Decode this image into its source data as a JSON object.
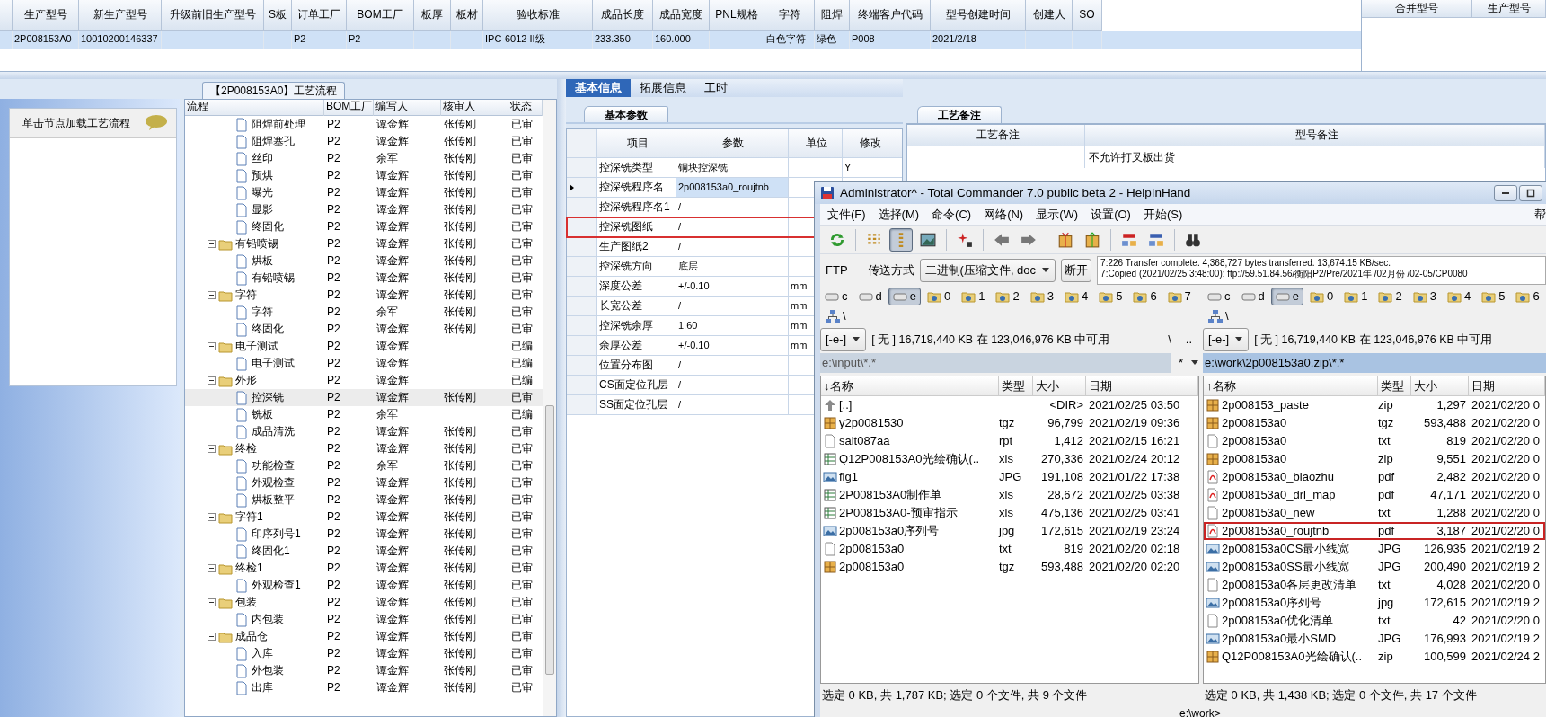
{
  "top_grid": {
    "columns": [
      "生产型号",
      "新生产型号",
      "升级前旧生产型号",
      "S板",
      "订单工厂",
      "BOM工厂",
      "板厚",
      "板材",
      "验收标准",
      "成品长度",
      "成品宽度",
      "PNL规格",
      "字符",
      "阻焊",
      "终端客户代码",
      "型号创建时间",
      "创建人",
      "SO"
    ],
    "rows": [
      {
        "selected": true,
        "cells": [
          "2P008153A0",
          "10010200146337",
          null,
          null,
          "P2",
          "P2",
          null,
          null,
          "IPC-6012 II级",
          "233.350",
          "160.000",
          null,
          "白色字符",
          "绿色",
          "P008",
          "2021/2/18",
          null,
          null
        ]
      }
    ]
  },
  "merge_grid": {
    "columns": [
      "合并型号",
      "生产型号"
    ]
  },
  "process_panel": {
    "title": "【2P008153A0】工艺流程",
    "hint": "单击节点加载工艺流程",
    "columns": [
      "流程",
      "BOM工厂",
      "编写人",
      "核审人",
      "状态"
    ],
    "items": [
      {
        "kind": "file",
        "name": "阻焊前处理",
        "cells": [
          "P2",
          "谭金辉",
          "张传刚",
          "已审"
        ],
        "selected": false
      },
      {
        "kind": "file",
        "name": "阻焊塞孔",
        "cells": [
          "P2",
          "谭金辉",
          "张传刚",
          "已审"
        ],
        "selected": false
      },
      {
        "kind": "file",
        "name": "丝印",
        "cells": [
          "P2",
          "余军",
          "张传刚",
          "已审"
        ],
        "selected": false
      },
      {
        "kind": "file",
        "name": "预烘",
        "cells": [
          "P2",
          "谭金辉",
          "张传刚",
          "已审"
        ],
        "selected": false
      },
      {
        "kind": "file",
        "name": "曝光",
        "cells": [
          "P2",
          "谭金辉",
          "张传刚",
          "已审"
        ],
        "selected": false
      },
      {
        "kind": "file",
        "name": "显影",
        "cells": [
          "P2",
          "谭金辉",
          "张传刚",
          "已审"
        ],
        "selected": false
      },
      {
        "kind": "file",
        "name": "终固化",
        "cells": [
          "P2",
          "谭金辉",
          "张传刚",
          "已审"
        ],
        "selected": false
      },
      {
        "kind": "folder",
        "name": "有铅喷锡",
        "cells": [
          "P2",
          "谭金辉",
          "张传刚",
          "已审"
        ],
        "selected": false,
        "expanded": true,
        "children": [
          {
            "kind": "file",
            "name": "烘板",
            "cells": [
              "P2",
              "谭金辉",
              "张传刚",
              "已审"
            ],
            "selected": false
          },
          {
            "kind": "file",
            "name": "有铅喷锡",
            "cells": [
              "P2",
              "谭金辉",
              "张传刚",
              "已审"
            ],
            "selected": false
          }
        ]
      },
      {
        "kind": "folder",
        "name": "字符",
        "cells": [
          "P2",
          "谭金辉",
          "张传刚",
          "已审"
        ],
        "selected": false,
        "expanded": true,
        "children": [
          {
            "kind": "file",
            "name": "字符",
            "cells": [
              "P2",
              "余军",
              "张传刚",
              "已审"
            ],
            "selected": false
          },
          {
            "kind": "file",
            "name": "终固化",
            "cells": [
              "P2",
              "谭金辉",
              "张传刚",
              "已审"
            ],
            "selected": false
          }
        ]
      },
      {
        "kind": "folder",
        "name": "电子测试",
        "cells": [
          "P2",
          "谭金辉",
          null,
          "已编"
        ],
        "selected": false,
        "expanded": true,
        "children": [
          {
            "kind": "file",
            "name": "电子测试",
            "cells": [
              "P2",
              "谭金辉",
              null,
              "已编"
            ],
            "selected": false
          }
        ]
      },
      {
        "kind": "folder",
        "name": "外形",
        "cells": [
          "P2",
          "谭金辉",
          null,
          "已编"
        ],
        "selected": false,
        "expanded": true,
        "children": [
          {
            "kind": "file",
            "name": "控深铣",
            "cells": [
              "P2",
              "谭金辉",
              "张传刚",
              "已审"
            ],
            "selected": true
          },
          {
            "kind": "file",
            "name": "铣板",
            "cells": [
              "P2",
              "余军",
              null,
              "已编"
            ],
            "selected": false
          },
          {
            "kind": "file",
            "name": "成品清洗",
            "cells": [
              "P2",
              "谭金辉",
              "张传刚",
              "已审"
            ],
            "selected": false
          }
        ]
      },
      {
        "kind": "folder",
        "name": "终检",
        "cells": [
          "P2",
          "谭金辉",
          "张传刚",
          "已审"
        ],
        "selected": false,
        "expanded": true,
        "children": [
          {
            "kind": "file",
            "name": "功能检查",
            "cells": [
              "P2",
              "余军",
              "张传刚",
              "已审"
            ],
            "selected": false
          },
          {
            "kind": "file",
            "name": "外观检查",
            "cells": [
              "P2",
              "谭金辉",
              "张传刚",
              "已审"
            ],
            "selected": false
          },
          {
            "kind": "file",
            "name": "烘板整平",
            "cells": [
              "P2",
              "谭金辉",
              "张传刚",
              "已审"
            ],
            "selected": false
          }
        ]
      },
      {
        "kind": "folder",
        "name": "字符1",
        "cells": [
          "P2",
          "谭金辉",
          "张传刚",
          "已审"
        ],
        "selected": false,
        "expanded": true,
        "children": [
          {
            "kind": "file",
            "name": "印序列号1",
            "cells": [
              "P2",
              "谭金辉",
              "张传刚",
              "已审"
            ],
            "selected": false
          },
          {
            "kind": "file",
            "name": "终固化1",
            "cells": [
              "P2",
              "谭金辉",
              "张传刚",
              "已审"
            ],
            "selected": false
          }
        ]
      },
      {
        "kind": "folder",
        "name": "终检1",
        "cells": [
          "P2",
          "谭金辉",
          "张传刚",
          "已审"
        ],
        "selected": false,
        "expanded": true,
        "children": [
          {
            "kind": "file",
            "name": "外观检查1",
            "cells": [
              "P2",
              "谭金辉",
              "张传刚",
              "已审"
            ],
            "selected": false
          }
        ]
      },
      {
        "kind": "folder",
        "name": "包装",
        "cells": [
          "P2",
          "谭金辉",
          "张传刚",
          "已审"
        ],
        "selected": false,
        "expanded": true,
        "children": [
          {
            "kind": "file",
            "name": "内包装",
            "cells": [
              "P2",
              "谭金辉",
              "张传刚",
              "已审"
            ],
            "selected": false
          }
        ]
      },
      {
        "kind": "folder",
        "name": "成品仓",
        "cells": [
          "P2",
          "谭金辉",
          "张传刚",
          "已审"
        ],
        "selected": false,
        "expanded": true,
        "children": [
          {
            "kind": "file",
            "name": "入库",
            "cells": [
              "P2",
              "谭金辉",
              "张传刚",
              "已审"
            ],
            "selected": false
          },
          {
            "kind": "file",
            "name": "外包装",
            "cells": [
              "P2",
              "谭金辉",
              "张传刚",
              "已审"
            ],
            "selected": false
          },
          {
            "kind": "file",
            "name": "出库",
            "cells": [
              "P2",
              "谭金辉",
              "张传刚",
              "已审"
            ],
            "selected": false
          }
        ]
      }
    ]
  },
  "info_tabs": [
    {
      "label": "基本信息",
      "selected": true
    },
    {
      "label": "拓展信息",
      "selected": false
    },
    {
      "label": "工时",
      "selected": false
    }
  ],
  "params": {
    "tab": "基本参数",
    "columns": [
      "项目",
      "参数",
      "单位",
      "修改"
    ],
    "rows": [
      {
        "item": "控深铣类型",
        "value": "铜块控深铣",
        "modify": "Y",
        "selected": false,
        "highlighted": false
      },
      {
        "item": "控深铣程序名",
        "value": "2p008153a0_roujtnb",
        "selected": true,
        "highlighted": false
      },
      {
        "item": "控深铣程序名1",
        "value": "/",
        "selected": false,
        "highlighted": false
      },
      {
        "item": "控深铣图纸",
        "value": "/",
        "selected": false,
        "highlighted": true
      },
      {
        "item": "生产图纸2",
        "value": "/",
        "selected": false,
        "highlighted": false
      },
      {
        "item": "控深铣方向",
        "value": "底层",
        "selected": false,
        "highlighted": false
      },
      {
        "item": "深度公差",
        "value": "+/-0.10",
        "unit": "mm",
        "selected": false,
        "highlighted": false
      },
      {
        "item": "长宽公差",
        "value": "/",
        "unit": "mm",
        "selected": false,
        "highlighted": false
      },
      {
        "item": "控深铣余厚",
        "value": "1.60",
        "unit": "mm",
        "selected": false,
        "highlighted": false
      },
      {
        "item": "余厚公差",
        "value": "+/-0.10",
        "unit": "mm",
        "selected": false,
        "highlighted": false
      },
      {
        "item": "位置分布图",
        "value": "/",
        "selected": false,
        "highlighted": false
      },
      {
        "item": "CS面定位孔层",
        "value": "/",
        "selected": false,
        "highlighted": false
      },
      {
        "item": "SS面定位孔层",
        "value": "/",
        "selected": false,
        "highlighted": false
      }
    ]
  },
  "notes": {
    "tab": "工艺备注",
    "columns": [
      "工艺备注",
      "型号备注"
    ],
    "model_note": "不允许打叉板出货"
  },
  "file_manager": {
    "title": "Administrator^ - Total Commander 7.0 public beta 2 - HelpInHand",
    "menu": [
      "文件(F)",
      "选择(M)",
      "命令(C)",
      "网络(N)",
      "显示(W)",
      "设置(O)",
      "开始(S)",
      "帮"
    ],
    "toolbar": [
      {
        "kind": "refresh",
        "selected": false
      },
      {
        "kind": "separator"
      },
      {
        "kind": "brief",
        "selected": false
      },
      {
        "kind": "detailed",
        "selected": true
      },
      {
        "kind": "thumbnails",
        "selected": false
      },
      {
        "kind": "separator"
      },
      {
        "kind": "star",
        "selected": false
      },
      {
        "kind": "separator"
      },
      {
        "kind": "back",
        "selected": false
      },
      {
        "kind": "forward",
        "selected": false
      },
      {
        "kind": "separator"
      },
      {
        "kind": "pack",
        "selected": false
      },
      {
        "kind": "unpack",
        "selected": false
      },
      {
        "kind": "separator"
      },
      {
        "kind": "ftp",
        "selected": false
      },
      {
        "kind": "url",
        "selected": false
      },
      {
        "kind": "separator"
      },
      {
        "kind": "find",
        "selected": false
      }
    ],
    "ftp": {
      "label": "FTP",
      "mode_label": "传送方式",
      "mode": "二进制(压缩文件, doc",
      "disconnect": "断开",
      "log": [
        "7:226 Transfer complete. 4,368,727 bytes transferred. 13,674.15 KB/sec.",
        "7:Copied (2021/02/25 3:48:00): ftp://59.51.84.56/衡阳P2/Pre/2021年 /02月份 /02-05/CP0080"
      ]
    },
    "panels": [
      {
        "active": false,
        "drives": [
          {
            "kind": "disk",
            "label": "c",
            "selected": false
          },
          {
            "kind": "disk",
            "label": "d",
            "selected": false
          },
          {
            "kind": "disk",
            "label": "e",
            "selected": true
          },
          {
            "kind": "net",
            "label": "0",
            "selected": false
          },
          {
            "kind": "net",
            "label": "1",
            "selected": false
          },
          {
            "kind": "net",
            "label": "2",
            "selected": false
          },
          {
            "kind": "net",
            "label": "3",
            "selected": false
          },
          {
            "kind": "net",
            "label": "4",
            "selected": false
          },
          {
            "kind": "net",
            "label": "5",
            "selected": false
          },
          {
            "kind": "net",
            "label": "6",
            "selected": false
          },
          {
            "kind": "net",
            "label": "7",
            "selected": false
          }
        ],
        "root": "\\",
        "drive": "[-e-]",
        "free_space": "[ 无 ]  16,719,440 KB 在 123,046,976 KB 中可用",
        "nav": [
          "\\",
          ".."
        ],
        "path": "e:\\input\\*.*",
        "filter": "*",
        "columns": [
          "↓名称",
          "类型",
          "大小",
          "日期"
        ],
        "files": [
          {
            "kind": "up",
            "name": "[..]",
            "size": "<DIR>",
            "date": "2021/02/25 03:50",
            "highlighted": false
          },
          {
            "kind": "archive",
            "name": "y2p0081530",
            "type": "tgz",
            "size": "96,799",
            "date": "2021/02/19 09:36",
            "highlighted": false
          },
          {
            "kind": "text",
            "name": "salt087aa",
            "type": "rpt",
            "size": "1,412",
            "date": "2021/02/15 16:21",
            "highlighted": false
          },
          {
            "kind": "sheet",
            "name": "Q12P008153A0光绘确认(..",
            "type": "xls",
            "size": "270,336",
            "date": "2021/02/24 20:12",
            "highlighted": false
          },
          {
            "kind": "image",
            "name": "fig1",
            "type": "JPG",
            "size": "191,108",
            "date": "2021/01/22 17:38",
            "highlighted": false
          },
          {
            "kind": "sheet",
            "name": "2P008153A0制作单",
            "type": "xls",
            "size": "28,672",
            "date": "2021/02/25 03:38",
            "highlighted": false
          },
          {
            "kind": "sheet",
            "name": "2P008153A0-预审指示",
            "type": "xls",
            "size": "475,136",
            "date": "2021/02/25 03:41",
            "highlighted": false
          },
          {
            "kind": "image",
            "name": "2p008153a0序列号",
            "type": "jpg",
            "size": "172,615",
            "date": "2021/02/19 23:24",
            "highlighted": false
          },
          {
            "kind": "text",
            "name": "2p008153a0",
            "type": "txt",
            "size": "819",
            "date": "2021/02/20 02:18",
            "highlighted": false
          },
          {
            "kind": "archive",
            "name": "2p008153a0",
            "type": "tgz",
            "size": "593,488",
            "date": "2021/02/20 02:20",
            "highlighted": false
          }
        ],
        "status": "选定 0 KB, 共 1,787 KB; 选定 0 个文件, 共 9 个文件"
      },
      {
        "active": true,
        "drives": [
          {
            "kind": "disk",
            "label": "c",
            "selected": false
          },
          {
            "kind": "disk",
            "label": "d",
            "selected": false
          },
          {
            "kind": "disk",
            "label": "e",
            "selected": true
          },
          {
            "kind": "net",
            "label": "0",
            "selected": false
          },
          {
            "kind": "net",
            "label": "1",
            "selected": false
          },
          {
            "kind": "net",
            "label": "2",
            "selected": false
          },
          {
            "kind": "net",
            "label": "3",
            "selected": false
          },
          {
            "kind": "net",
            "label": "4",
            "selected": false
          },
          {
            "kind": "net",
            "label": "5",
            "selected": false
          },
          {
            "kind": "net",
            "label": "6",
            "selected": false
          }
        ],
        "root": "\\",
        "drive": "[-e-]",
        "free_space": "[ 无 ]  16,719,440 KB 在 123,046,976 KB 中可用",
        "path": "e:\\work\\2p008153a0.zip\\*.*",
        "columns": [
          "↑名称",
          "类型",
          "大小",
          "日期"
        ],
        "files": [
          {
            "kind": "archive",
            "name": "2p008153_paste",
            "type": "zip",
            "size": "1,297",
            "date": "2021/02/20 0",
            "highlighted": false
          },
          {
            "kind": "archive",
            "name": "2p008153a0",
            "type": "tgz",
            "size": "593,488",
            "date": "2021/02/20 0",
            "highlighted": false
          },
          {
            "kind": "text",
            "name": "2p008153a0",
            "type": "txt",
            "size": "819",
            "date": "2021/02/20 0",
            "highlighted": false
          },
          {
            "kind": "archive",
            "name": "2p008153a0",
            "type": "zip",
            "size": "9,551",
            "date": "2021/02/20 0",
            "highlighted": false
          },
          {
            "kind": "pdf",
            "name": "2p008153a0_biaozhu",
            "type": "pdf",
            "size": "2,482",
            "date": "2021/02/20 0",
            "highlighted": false
          },
          {
            "kind": "pdf",
            "name": "2p008153a0_drl_map",
            "type": "pdf",
            "size": "47,171",
            "date": "2021/02/20 0",
            "highlighted": false
          },
          {
            "kind": "text",
            "name": "2p008153a0_new",
            "type": "txt",
            "size": "1,288",
            "date": "2021/02/20 0",
            "highlighted": false
          },
          {
            "kind": "pdf",
            "name": "2p008153a0_roujtnb",
            "type": "pdf",
            "size": "3,187",
            "date": "2021/02/20 0",
            "highlighted": true
          },
          {
            "kind": "image",
            "name": "2p008153a0CS最小线宽",
            "type": "JPG",
            "size": "126,935",
            "date": "2021/02/19 2",
            "highlighted": false
          },
          {
            "kind": "image",
            "name": "2p008153a0SS最小线宽",
            "type": "JPG",
            "size": "200,490",
            "date": "2021/02/19 2",
            "highlighted": false
          },
          {
            "kind": "text",
            "name": "2p008153a0各层更改清单",
            "type": "txt",
            "size": "4,028",
            "date": "2021/02/20 0",
            "highlighted": false
          },
          {
            "kind": "image",
            "name": "2p008153a0序列号",
            "type": "jpg",
            "size": "172,615",
            "date": "2021/02/19 2",
            "highlighted": false
          },
          {
            "kind": "text",
            "name": "2p008153a0优化清单",
            "type": "txt",
            "size": "42",
            "date": "2021/02/20 0",
            "highlighted": false
          },
          {
            "kind": "image",
            "name": "2p008153a0最小SMD",
            "type": "JPG",
            "size": "176,993",
            "date": "2021/02/19 2",
            "highlighted": false
          },
          {
            "kind": "archive",
            "name": "Q12P008153A0光绘确认(..",
            "type": "zip",
            "size": "100,599",
            "date": "2021/02/24 2",
            "highlighted": false
          }
        ],
        "status": "选定 0 KB, 共 1,438 KB; 选定 0 个文件, 共 17 个文件"
      }
    ],
    "command_prompt": "e:\\work>"
  }
}
